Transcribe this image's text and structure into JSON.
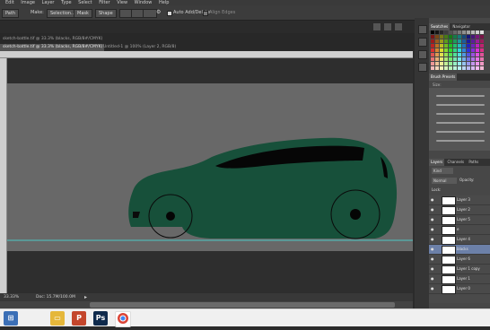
{
  "menu": [
    "Edit",
    "Image",
    "Layer",
    "Type",
    "Select",
    "Filter",
    "View",
    "Window",
    "Help"
  ],
  "options": {
    "mode": "Path",
    "make_label": "Make:",
    "selection_btn": "Selection...",
    "mask_btn": "Mask",
    "shape_btn": "Shape",
    "auto_add": "Auto Add/Delete",
    "align_edges": "Align Edges"
  },
  "tabs": [
    {
      "label": "sketch-battle.tif @ 33.3% (blacks, RGB/8#/CMYK)"
    },
    {
      "label": "sketch-battle.tif @ 33.3% (blacks, RGB/8#/CMYK)"
    },
    {
      "label": "Untitled-1 @ 100% (Layer 2, RGB/8)"
    }
  ],
  "status": {
    "zoom": "33.33%",
    "doc": "Doc: 15.7M/100.0M"
  },
  "swatches_panel": {
    "tab1": "Swatches",
    "tab2": "Navigator"
  },
  "brush_panel": {
    "title": "Brush Presets",
    "size_label": "Size:"
  },
  "layers_panel": {
    "tabs": [
      "Layers",
      "Channels",
      "Paths"
    ],
    "kind_filter": "Kind",
    "blend_mode": "Normal",
    "opacity_label": "Opacity:",
    "lock_label": "Lock:",
    "layers": [
      {
        "name": "Layer 3"
      },
      {
        "name": "Layer 2"
      },
      {
        "name": "Layer 5"
      },
      {
        "name": "e"
      },
      {
        "name": "Layer 4"
      },
      {
        "name": "blacks"
      },
      {
        "name": "Layer 6"
      },
      {
        "name": "Layer 1 copy"
      },
      {
        "name": "Layer 1"
      },
      {
        "name": "Layer 0"
      }
    ]
  },
  "taskbar_apps": [
    "explorer",
    "word",
    "powerpoint",
    "photoshop",
    "chrome"
  ],
  "colors": {
    "car_body": "#17503a",
    "canvas_bg": "#686868",
    "guide_line": "#4cc7c4",
    "selected_layer": "#6c80a8"
  }
}
